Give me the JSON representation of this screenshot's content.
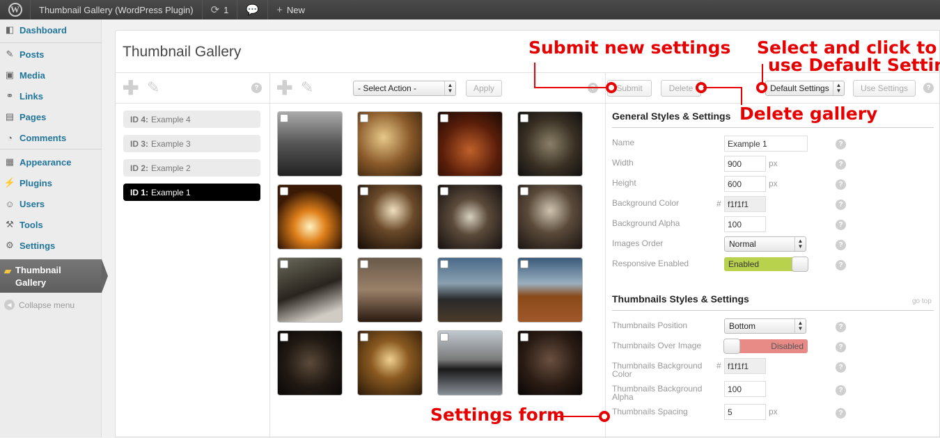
{
  "adminbar": {
    "site_title": "Thumbnail Gallery (WordPress Plugin)",
    "updates_count": "1",
    "new_label": "New"
  },
  "sidebar": {
    "items": [
      {
        "label": "Dashboard",
        "icon": "dashboard-icon"
      },
      {
        "label": "Posts",
        "icon": "pin-icon"
      },
      {
        "label": "Media",
        "icon": "media-icon"
      },
      {
        "label": "Links",
        "icon": "link-icon"
      },
      {
        "label": "Pages",
        "icon": "page-icon"
      },
      {
        "label": "Comments",
        "icon": "comment-icon"
      },
      {
        "label": "Appearance",
        "icon": "appearance-icon"
      },
      {
        "label": "Plugins",
        "icon": "plugin-icon"
      },
      {
        "label": "Users",
        "icon": "users-icon"
      },
      {
        "label": "Tools",
        "icon": "tools-icon"
      },
      {
        "label": "Settings",
        "icon": "settings-icon"
      }
    ],
    "current_line1": "Thumbnail",
    "current_line2": "Gallery",
    "collapse_label": "Collapse menu"
  },
  "main": {
    "title": "Thumbnail Gallery",
    "select_action": "- Select Action -",
    "apply_label": "Apply",
    "submit_label": "Submit",
    "delete_label": "Delete",
    "default_settings": "Default Settings",
    "use_settings_label": "Use Settings"
  },
  "galleries": [
    {
      "id": "ID 4:",
      "name": "Example 4",
      "active": false
    },
    {
      "id": "ID 3:",
      "name": "Example 3",
      "active": false
    },
    {
      "id": "ID 2:",
      "name": "Example 2",
      "active": false
    },
    {
      "id": "ID 1:",
      "name": "Example 1",
      "active": true
    }
  ],
  "settings": {
    "general_title": "General Styles & Settings",
    "name_label": "Name",
    "name_value": "Example  1",
    "width_label": "Width",
    "width_value": "900",
    "width_unit": "px",
    "height_label": "Height",
    "height_value": "600",
    "height_unit": "px",
    "bgcolor_label": "Background Color",
    "bgcolor_hash": "#",
    "bgcolor_value": "f1f1f1",
    "bgalpha_label": "Background Alpha",
    "bgalpha_value": "100",
    "order_label": "Images Order",
    "order_value": "Normal",
    "responsive_label": "Responsive Enabled",
    "responsive_value": "Enabled",
    "thumbs_title": "Thumbnails Styles & Settings",
    "go_top": "go top",
    "tpos_label": "Thumbnails Position",
    "tpos_value": "Bottom",
    "tover_label": "Thumbnails Over Image",
    "tover_value": "Disabled",
    "tbg_label_1": "Thumbnails Background",
    "tbg_label_2": "Color",
    "tbg_hash": "#",
    "tbg_value": "f1f1f1",
    "tbga_label_1": "Thumbnails Background",
    "tbga_label_2": "Alpha",
    "tbga_value": "100",
    "tspace_label": "Thumbnails Spacing",
    "tspace_value": "5",
    "tspace_unit": "px"
  },
  "annotations": {
    "submit": "Submit new settings",
    "default_1": "Select and click to",
    "default_2": "use Default Settings",
    "delete": "Delete gallery",
    "form": "Settings form"
  },
  "colors": {
    "annotation_red": "#e60000",
    "link_blue": "#21759b",
    "toggle_on": "#b9d24d",
    "toggle_off": "#e88a86"
  }
}
